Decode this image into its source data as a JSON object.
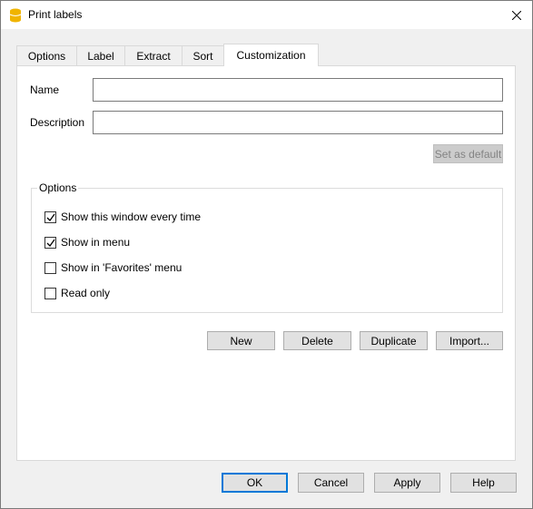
{
  "window": {
    "title": "Print labels",
    "close_glyph": "✕",
    "app_icon": "database-icon"
  },
  "tabs": [
    {
      "label": "Options",
      "active": false
    },
    {
      "label": "Label",
      "active": false
    },
    {
      "label": "Extract",
      "active": false
    },
    {
      "label": "Sort",
      "active": false
    },
    {
      "label": "Customization",
      "active": true
    }
  ],
  "form": {
    "name_label": "Name",
    "name_value": "",
    "description_label": "Description",
    "description_value": "",
    "set_default_label": "Set as default"
  },
  "options_group": {
    "title": "Options",
    "items": [
      {
        "label": "Show this window every time",
        "checked": true
      },
      {
        "label": "Show in menu",
        "checked": true
      },
      {
        "label": "Show in 'Favorites' menu",
        "checked": false
      },
      {
        "label": "Read only",
        "checked": false
      }
    ]
  },
  "actions": {
    "new_label": "New",
    "delete_label": "Delete",
    "duplicate_label": "Duplicate",
    "import_label": "Import..."
  },
  "footer": {
    "ok_label": "OK",
    "cancel_label": "Cancel",
    "apply_label": "Apply",
    "help_label": "Help"
  },
  "colors": {
    "accent": "#0078d7",
    "app_icon": "#f0b400"
  }
}
